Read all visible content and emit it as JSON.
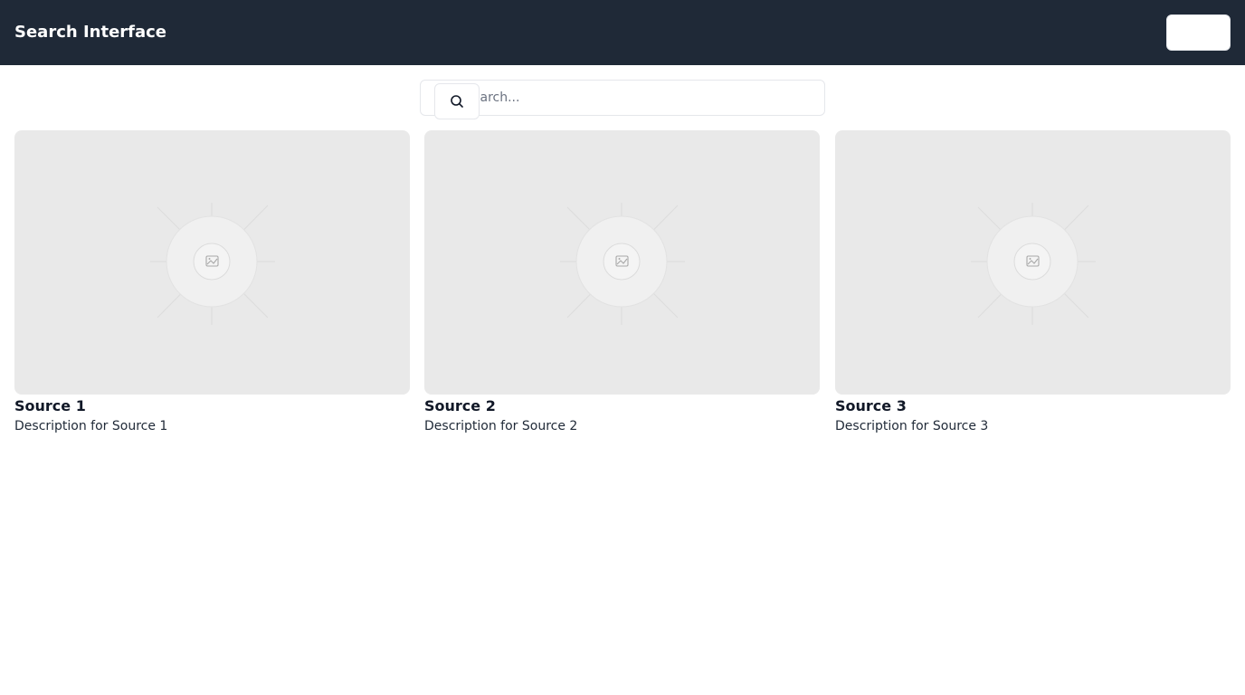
{
  "header": {
    "title": "Search Interface",
    "action_label": ""
  },
  "search": {
    "placeholder": "Search...",
    "value": "",
    "icon": "search-icon"
  },
  "cards": [
    {
      "title": "Source 1",
      "description": "Description for Source 1",
      "image_icon": "image-placeholder-icon"
    },
    {
      "title": "Source 2",
      "description": "Description for Source 2",
      "image_icon": "image-placeholder-icon"
    },
    {
      "title": "Source 3",
      "description": "Description for Source 3",
      "image_icon": "image-placeholder-icon"
    }
  ],
  "colors": {
    "header_bg": "#1f2937",
    "header_text": "#ffffff",
    "placeholder_bg": "#e9e9e9",
    "border": "#e5e7eb"
  }
}
